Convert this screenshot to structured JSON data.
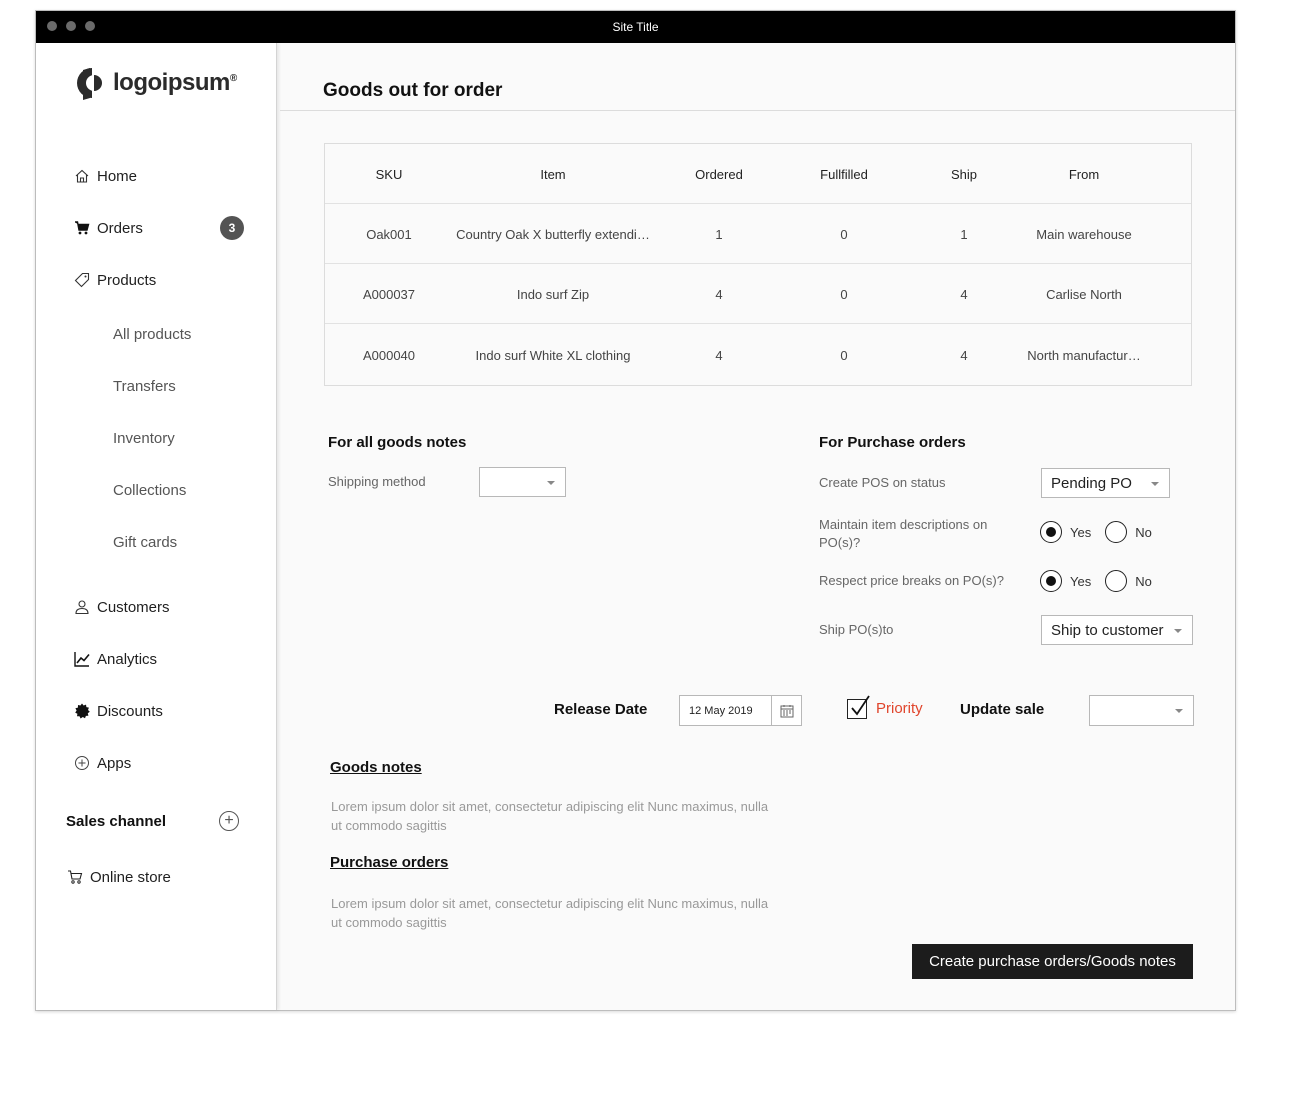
{
  "window": {
    "title": "Site Title"
  },
  "sidebar": {
    "logo_text": "logoipsum",
    "logo_mark": "®",
    "nav": [
      {
        "label": "Home",
        "icon": "home-icon"
      },
      {
        "label": "Orders",
        "icon": "cart-icon",
        "badge": "3"
      },
      {
        "label": "Products",
        "icon": "tag-icon"
      }
    ],
    "product_subitems": [
      "All products",
      "Transfers",
      "Inventory",
      "Collections",
      "Gift cards"
    ],
    "nav2": [
      {
        "label": "Customers",
        "icon": "person-icon"
      },
      {
        "label": "Analytics",
        "icon": "chart-icon"
      },
      {
        "label": "Discounts",
        "icon": "discount-icon"
      },
      {
        "label": "Apps",
        "icon": "plus-circle-icon"
      }
    ],
    "sales_channel": {
      "heading": "Sales channel",
      "add_icon": "+",
      "item": "Online store"
    }
  },
  "main": {
    "title": "Goods out for order",
    "table": {
      "headers": [
        "SKU",
        "Item",
        "Ordered",
        "Fullfilled",
        "Ship",
        "From"
      ],
      "rows": [
        [
          "Oak001",
          "Country Oak X butterfly extendi…",
          "1",
          "0",
          "1",
          "Main warehouse"
        ],
        [
          "A000037",
          "Indo surf Zip",
          "4",
          "0",
          "4",
          "Carlise North"
        ],
        [
          "A000040",
          "Indo surf White XL clothing",
          "4",
          "0",
          "4",
          "North manufactur…"
        ]
      ]
    },
    "goods_notes_form": {
      "heading": "For all goods notes",
      "shipping_label": "Shipping method",
      "shipping_value": ""
    },
    "purchase_form": {
      "heading": "For Purchase orders",
      "status_label": "Create POS on status",
      "status_value": "Pending PO",
      "maintain_label": "Maintain item descriptions on PO(s)?",
      "price_label": "Respect price breaks on PO(s)?",
      "yes": "Yes",
      "no": "No",
      "ship_label": "Ship PO(s)to",
      "ship_value": "Ship to customer"
    },
    "release": {
      "label": "Release Date",
      "date": "12 May 2019",
      "priority": "Priority",
      "priority_checked": true,
      "update_label": "Update sale",
      "update_value": ""
    },
    "goods_notes": {
      "heading": "Goods notes",
      "text": "Lorem ipsum dolor sit amet, consectetur adipiscing elit Nunc maximus, nulla ut commodo sagittis"
    },
    "purchase_orders": {
      "heading": "Purchase orders",
      "text": "Lorem ipsum dolor sit amet, consectetur adipiscing elit Nunc maximus, nulla ut commodo sagittis"
    },
    "primary_button": "Create purchase orders/Goods notes"
  },
  "colors": {
    "priority": "#e0452c",
    "button": "#1c1c1c",
    "titlebar": "#000000"
  }
}
